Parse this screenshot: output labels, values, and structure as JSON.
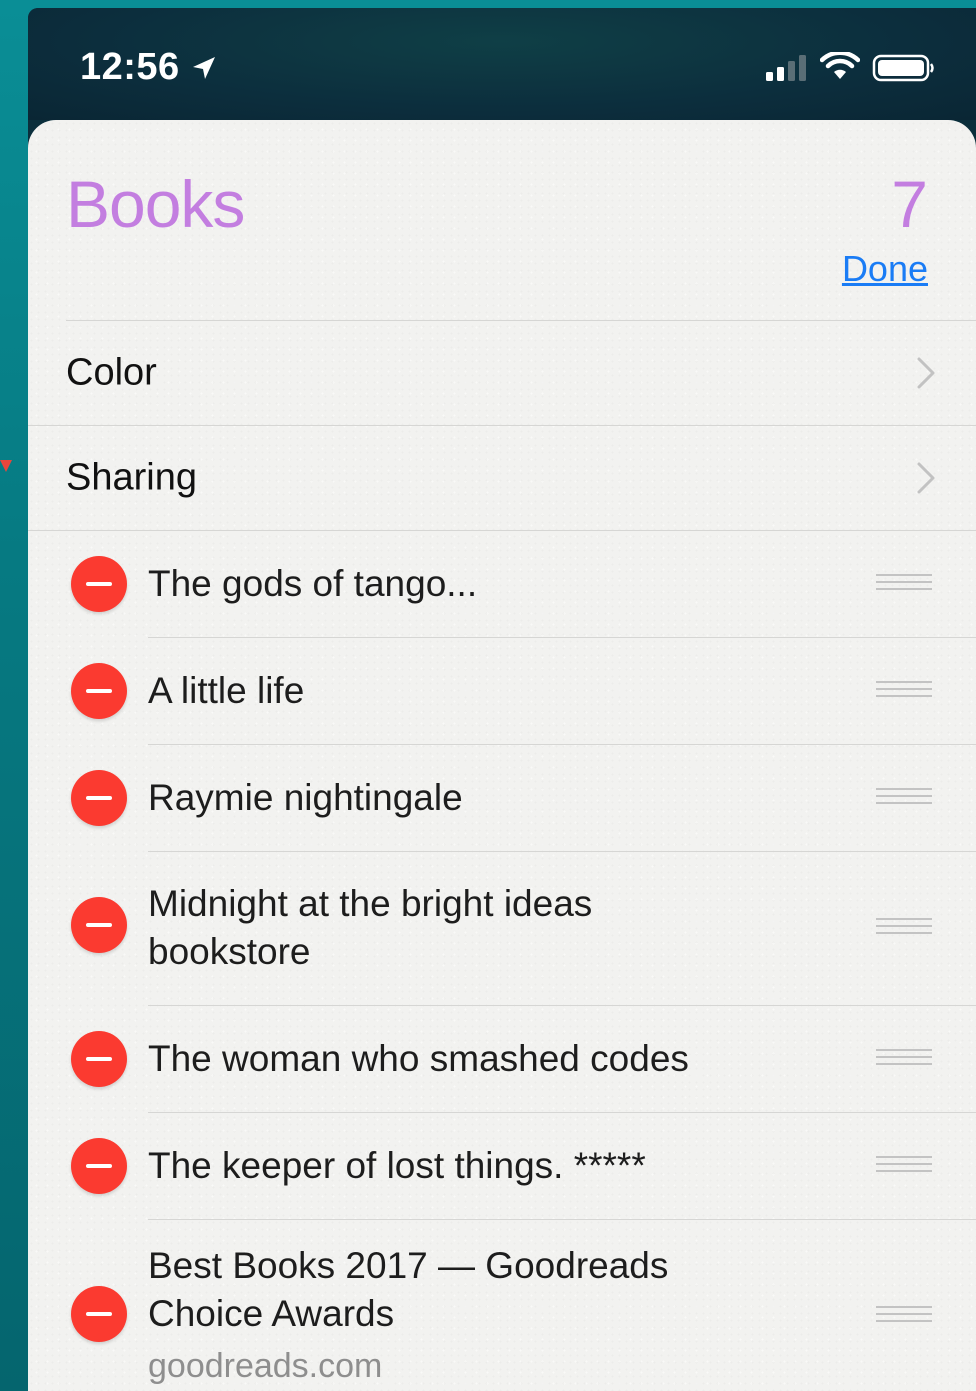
{
  "status_bar": {
    "time": "12:56",
    "icons": [
      "location-arrow-icon",
      "cellular-signal-icon",
      "wifi-icon",
      "battery-icon"
    ]
  },
  "list": {
    "title": "Books",
    "count": "7",
    "done_label": "Done",
    "accent_color": "#c37ee0",
    "link_color": "#1a7cf5",
    "delete_color": "#fb3a30"
  },
  "settings": [
    {
      "label": "Color",
      "icon": "chevron-right-icon"
    },
    {
      "label": "Sharing",
      "icon": "chevron-right-icon"
    }
  ],
  "items": [
    {
      "text": "The gods of tango..."
    },
    {
      "text": "A little life"
    },
    {
      "text": "Raymie nightingale"
    },
    {
      "text": "Midnight at the bright ideas bookstore"
    },
    {
      "text": "The woman who smashed codes"
    },
    {
      "text": "The keeper of lost things. *****"
    },
    {
      "text": "Best Books 2017 — Goodreads Choice Awards",
      "subtitle": "goodreads.com"
    }
  ]
}
